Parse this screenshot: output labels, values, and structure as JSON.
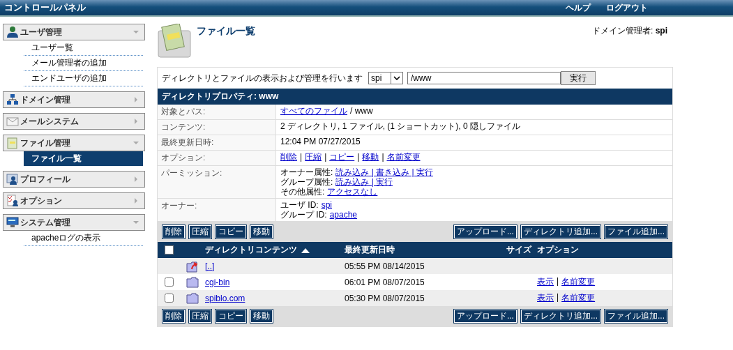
{
  "header": {
    "title": "コントロールパネル",
    "links": [
      "ヘルプ",
      "ログアウト"
    ]
  },
  "sidebar": {
    "sections": [
      {
        "kind": "user",
        "label": "ユーザ管理",
        "expanded": true,
        "items": [
          {
            "label": "ユーザー覧",
            "selected": false
          },
          {
            "label": "メール管理者の追加",
            "selected": false
          },
          {
            "label": "エンドユーザの追加",
            "selected": false
          }
        ]
      },
      {
        "kind": "network",
        "label": "ドメイン管理",
        "expanded": false
      },
      {
        "kind": "mail",
        "label": "メールシステム",
        "expanded": false
      },
      {
        "kind": "file",
        "label": "ファイル管理",
        "expanded": true,
        "items": [
          {
            "label": "ファイル一覧",
            "selected": true
          }
        ]
      },
      {
        "kind": "profile",
        "label": "プロフィール",
        "expanded": false
      },
      {
        "kind": "options",
        "label": "オプション",
        "expanded": false
      },
      {
        "kind": "system",
        "label": "システム管理",
        "expanded": true,
        "items": [
          {
            "label": "apacheログの表示",
            "selected": false
          }
        ]
      }
    ]
  },
  "page": {
    "title": "ファイル一覧",
    "admin_label": "ドメイン管理者:",
    "admin_name": "spi"
  },
  "browse": {
    "label": "ディレクトリとファイルの表示および管理を行います",
    "owner_select": "spi",
    "path": "/www",
    "submit": "実行"
  },
  "properties": {
    "title": "ディレクトリプロパティ: www",
    "rows": [
      {
        "label": "対象とパス:",
        "lines": [
          [
            {
              "text": "すべてのファイル",
              "link": true
            },
            {
              "text": "/ www",
              "link": false
            }
          ]
        ]
      },
      {
        "label": "コンテンツ:",
        "lines": [
          [
            {
              "text": "2 ディレクトリ, 1 ファイル, (1 ショートカット), 0 隠しファイル",
              "link": false
            }
          ]
        ]
      },
      {
        "label": "最終更新日時:",
        "lines": [
          [
            {
              "text": "12:04 PM 07/27/2015",
              "link": false
            }
          ]
        ]
      },
      {
        "label": "オプション:",
        "lines": [
          [
            {
              "text": "削除",
              "link": true
            },
            {
              "text": "|",
              "link": false
            },
            {
              "text": "圧縮",
              "link": true
            },
            {
              "text": "|",
              "link": false
            },
            {
              "text": "コピー",
              "link": true
            },
            {
              "text": "|",
              "link": false
            },
            {
              "text": "移動",
              "link": true
            },
            {
              "text": "|",
              "link": false
            },
            {
              "text": "名前変更",
              "link": true
            }
          ]
        ]
      },
      {
        "label": "パーミッション:",
        "lines": [
          [
            {
              "text": "オーナー属性:",
              "link": false
            },
            {
              "text": "読み込み | 書き込み | 実行",
              "link": true
            }
          ],
          [
            {
              "text": "グループ属性:",
              "link": false
            },
            {
              "text": "読み込み | 実行",
              "link": true
            }
          ],
          [
            {
              "text": "その他属性:",
              "link": false
            },
            {
              "text": "アクセスなし",
              "link": true
            }
          ]
        ]
      },
      {
        "label": "オーナー:",
        "lines": [
          [
            {
              "text": "ユーザ ID:",
              "link": false
            },
            {
              "text": "spi",
              "link": true
            }
          ],
          [
            {
              "text": "グループ ID:",
              "link": false
            },
            {
              "text": "apache",
              "link": true
            }
          ]
        ]
      }
    ]
  },
  "actions": {
    "left": [
      "削除",
      "圧縮",
      "コピー",
      "移動"
    ],
    "right": [
      "アップロード...",
      "ディレクトリ追加...",
      "ファイル追加..."
    ]
  },
  "table": {
    "columns": [
      "ディレクトリコンテンツ",
      "最終更新日時",
      "サイズ",
      "オプション"
    ],
    "sort_ascending": true,
    "header_checked": false,
    "rows": [
      {
        "kind": "parent",
        "name": "[..]",
        "modified": "05:55 PM 08/14/2015"
      },
      {
        "kind": "folder",
        "name": "cgi-bin",
        "modified": "06:01 PM 08/07/2015",
        "checked": false,
        "options": [
          {
            "text": "表示",
            "link": true
          },
          {
            "text": "|",
            "link": false
          },
          {
            "text": "名前変更",
            "link": true
          }
        ]
      },
      {
        "kind": "folder",
        "name": "spiblo.com",
        "modified": "05:30 PM 08/07/2015",
        "checked": false,
        "options": [
          {
            "text": "表示",
            "link": true
          },
          {
            "text": "|",
            "link": false
          },
          {
            "text": "名前変更",
            "link": true
          }
        ]
      }
    ]
  },
  "bottom_actions": {
    "left": [
      "削除",
      "圧縮",
      "コピー",
      "移動"
    ],
    "right": [
      "アップロード...",
      "ディレクトリ追加...",
      "ファイル追加..."
    ]
  }
}
